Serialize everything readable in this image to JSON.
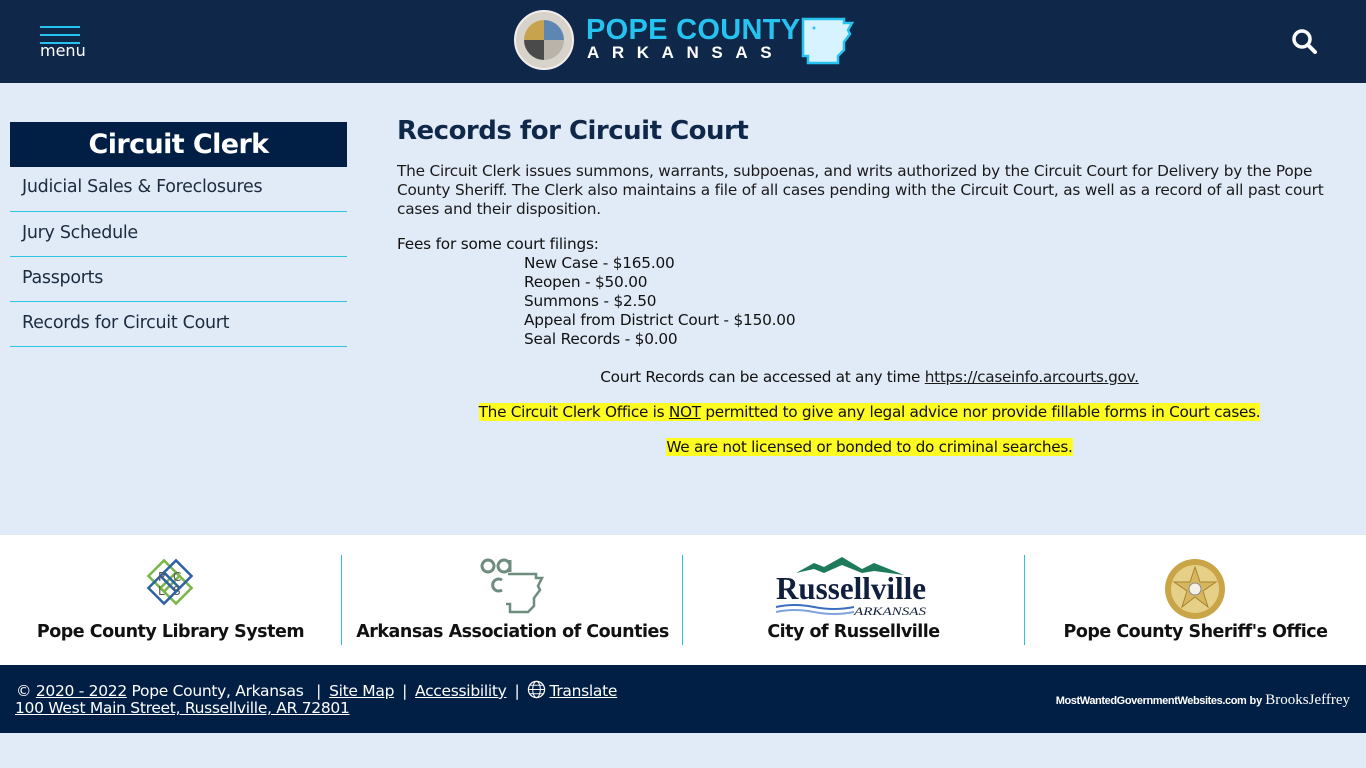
{
  "header": {
    "menu_label": "menu",
    "logo_title": "POPE COUNTY",
    "logo_subtitle": "ARKANSAS",
    "search_icon": "search-icon",
    "colors": {
      "bar": "#0f2749",
      "accent": "#27c3f0"
    }
  },
  "sidebar": {
    "title": "Circuit Clerk",
    "items": [
      {
        "label": "Judicial Sales & Foreclosures"
      },
      {
        "label": "Jury Schedule"
      },
      {
        "label": "Passports"
      },
      {
        "label": "Records for Circuit Court"
      }
    ]
  },
  "main": {
    "title": "Records for Circuit Court",
    "intro": "The Circuit Clerk issues summons, warrants, subpoenas, and writs authorized by the Circuit Court for Delivery by the Pope County Sheriff. The Clerk also maintains a file of all cases pending with the Circuit Court, as well as a record of all past court cases and their disposition.",
    "fees_label": "Fees for some court filings:",
    "fees": [
      "New Case - $165.00",
      "Reopen - $50.00",
      "Summons - $2.50",
      "Appeal from District Court - $150.00",
      "Seal Records - $0.00"
    ],
    "records_text": "Court Records can be accessed at any time ",
    "records_link": "https://caseinfo.arcourts.gov.",
    "notice1_pre": "The Circuit Clerk Office is ",
    "notice1_emph": "NOT",
    "notice1_post": " permitted to give any legal advice nor provide fillable forms in Court cases.",
    "notice2": "We are not licensed or bonded to do criminal searches.",
    "highlight_color": "#fffc22"
  },
  "partners": [
    {
      "name": "Pope County Library System",
      "icon": "pcls-logo-icon"
    },
    {
      "name": "Arkansas Association of Counties",
      "icon": "aac-logo-icon"
    },
    {
      "name": "City of Russellville",
      "icon": "russellville-logo-icon",
      "logo_text": "Russellville",
      "logo_sub": "ARKANSAS"
    },
    {
      "name": "Pope County Sheriff's Office",
      "icon": "sheriff-badge-icon"
    }
  ],
  "footer": {
    "copyright": "©",
    "years": "2020 - 2022",
    "org": "Pope County, Arkansas",
    "separator": "|",
    "site_map": "Site Map",
    "accessibility": "Accessibility",
    "translate": "Translate",
    "address": "100 West Main Street, Russellville, AR 72801",
    "credit_site": "MostWantedGovernmentWebsites.com",
    "credit_by": "by",
    "credit_company": "BrooksJeffrey"
  }
}
